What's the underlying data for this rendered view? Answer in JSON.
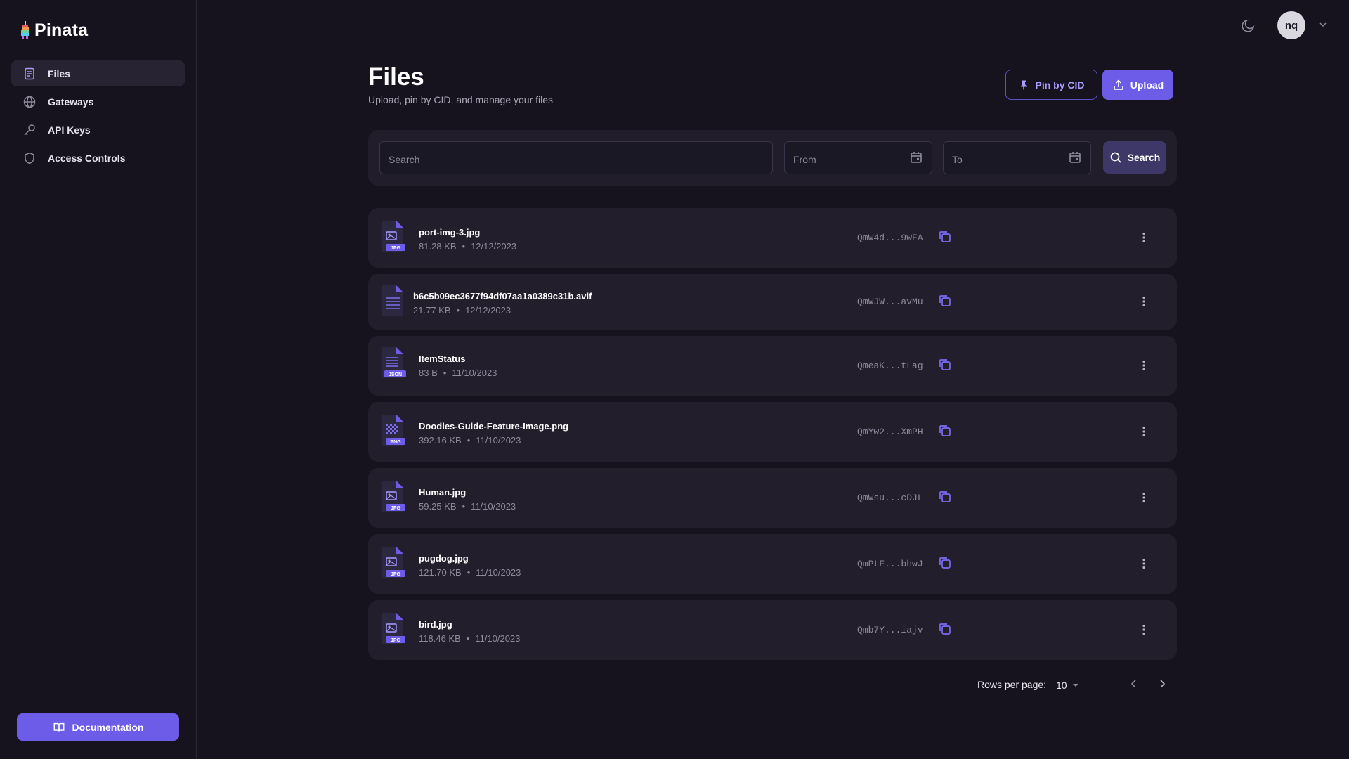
{
  "brand": {
    "name": "Pinata"
  },
  "sidebar": {
    "items": [
      {
        "label": "Files",
        "icon": "file-icon",
        "active": true
      },
      {
        "label": "Gateways",
        "icon": "globe-icon",
        "active": false
      },
      {
        "label": "API Keys",
        "icon": "key-icon",
        "active": false
      },
      {
        "label": "Access Controls",
        "icon": "shield-icon",
        "active": false
      }
    ],
    "documentation_label": "Documentation"
  },
  "topbar": {
    "avatar_initials": "nq",
    "theme_icon": "moon-icon"
  },
  "header": {
    "title": "Files",
    "subtitle": "Upload, pin by CID, and manage your files",
    "pin_label": "Pin by CID",
    "upload_label": "Upload"
  },
  "filters": {
    "search_placeholder": "Search",
    "from_placeholder": "From",
    "to_placeholder": "To",
    "search_button": "Search"
  },
  "files": [
    {
      "name": "port-img-3.jpg",
      "size": "81.28 KB",
      "date": "12/12/2023",
      "cid": "QmW4d...9wFA",
      "type": "JPG"
    },
    {
      "name": "b6c5b09ec3677f94df07aa1a0389c31b.avif",
      "size": "21.77 KB",
      "date": "12/12/2023",
      "cid": "QmWJW...avMu",
      "type": ""
    },
    {
      "name": "ItemStatus",
      "size": "83 B",
      "date": "11/10/2023",
      "cid": "QmeaK...tLag",
      "type": "JSON"
    },
    {
      "name": "Doodles-Guide-Feature-Image.png",
      "size": "392.16 KB",
      "date": "11/10/2023",
      "cid": "QmYw2...XmPH",
      "type": "PNG"
    },
    {
      "name": "Human.jpg",
      "size": "59.25 KB",
      "date": "11/10/2023",
      "cid": "QmWsu...cDJL",
      "type": "JPG"
    },
    {
      "name": "pugdog.jpg",
      "size": "121.70 KB",
      "date": "11/10/2023",
      "cid": "QmPtF...bhwJ",
      "type": "JPG"
    },
    {
      "name": "bird.jpg",
      "size": "118.46 KB",
      "date": "11/10/2023",
      "cid": "Qmb7Y...iajv",
      "type": "JPG"
    }
  ],
  "pagination": {
    "rows_label": "Rows per page:",
    "rows_value": "10"
  },
  "colors": {
    "accent": "#6c5ce7",
    "background": "#16131f",
    "card": "#221e2c"
  }
}
